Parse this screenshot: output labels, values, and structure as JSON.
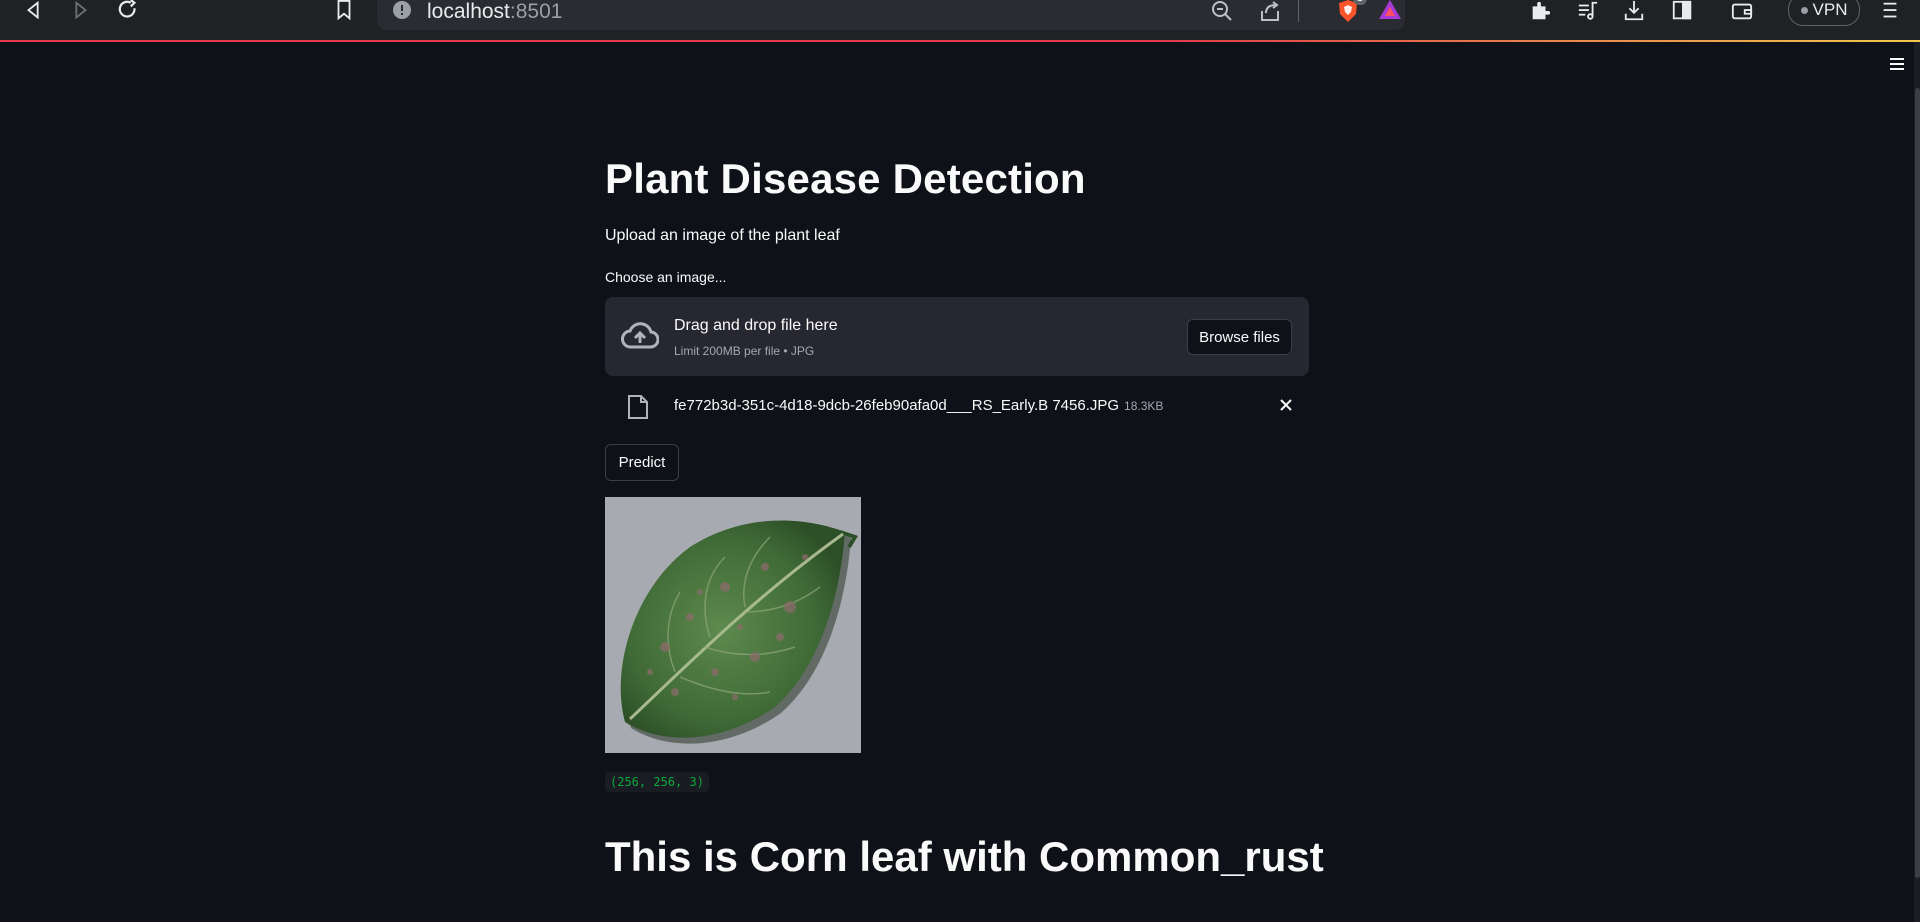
{
  "browser": {
    "url_host": "localhost",
    "url_port": ":8501",
    "brave_badge_count": "1",
    "vpn_label": "VPN",
    "icons": [
      "back-icon",
      "forward-icon",
      "reload-icon",
      "bookmark-icon",
      "site-info-icon",
      "zoom-out-icon",
      "share-icon",
      "brave-shields-icon",
      "brave-rewards-icon",
      "extensions-icon",
      "media-icon",
      "downloads-icon",
      "sidebar-icon",
      "wallet-icon",
      "menu-icon"
    ]
  },
  "app": {
    "title": "Plant Disease Detection",
    "subtitle": "Upload an image of the plant leaf",
    "uploader": {
      "label": "Choose an image...",
      "drop_text": "Drag and drop file here",
      "limit_text": "Limit 200MB per file • JPG",
      "browse_label": "Browse files"
    },
    "uploaded_file": {
      "name": "fe772b3d-351c-4d18-9dcb-26feb90afa0d___RS_Early.B 7456.JPG",
      "size": "18.3KB"
    },
    "predict_label": "Predict",
    "image_shape": "(256, 256, 3)",
    "result_text": "This is Corn leaf with Common_rust"
  },
  "colors": {
    "background": "#0e1117",
    "dropzone": "#262730",
    "code_text": "#09ab3b",
    "accent_line": "#e2394b"
  }
}
